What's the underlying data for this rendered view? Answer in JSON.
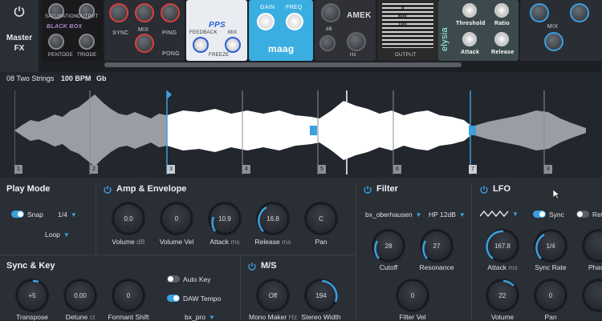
{
  "fx": {
    "label_line1": "Master",
    "label_line2": "FX",
    "plugins": {
      "blackbox": {
        "saturation": "SATURATION",
        "output": "OUTPUT",
        "brand": "BLACK BOX",
        "pentode": "PENTODE",
        "triode": "TRIODE"
      },
      "delay": {
        "sync": "SYNC",
        "mix": "MIX",
        "ping": "PING",
        "pong": "PONG"
      },
      "pps": {
        "brand": "PPS",
        "feedback": "FEEDBACK",
        "mix": "MIX",
        "freeze": "FREEZE"
      },
      "maag": {
        "gain": "GAIN",
        "freq": "FREQ",
        "brand": "maag"
      },
      "amek": {
        "brand": "AMEK",
        "db": "dB",
        "hz": "Hz"
      },
      "spl": {
        "output": "OUTPUT",
        "db1": "0",
        "db2": "800",
        "db3": "100"
      },
      "elysia": {
        "brand": "elysia",
        "threshold": "Threshold",
        "ratio": "Ratio",
        "attack": "Attack",
        "release": "Release"
      },
      "last": {
        "mix": "MIX"
      }
    }
  },
  "sample": {
    "name": "08 Two Strings",
    "bpm": "100 BPM",
    "key": "Gb"
  },
  "slices": [
    "1",
    "2",
    "3",
    "4",
    "5",
    "6",
    "7",
    "8"
  ],
  "play_mode": {
    "title": "Play Mode",
    "snap_label": "Snap",
    "snap_value": "1/4",
    "loop_value": "Loop"
  },
  "amp": {
    "title": "Amp & Envelope",
    "knobs": [
      {
        "value": "0.0",
        "label": "Volume",
        "unit": "dB"
      },
      {
        "value": "0",
        "label": "Volume Vel",
        "unit": ""
      },
      {
        "value": "10.9",
        "label": "Attack",
        "unit": "ms"
      },
      {
        "value": "16.8",
        "label": "Release",
        "unit": "ms"
      },
      {
        "value": "C",
        "label": "Pan",
        "unit": ""
      }
    ]
  },
  "filter": {
    "title": "Filter",
    "type": "bx_oberhausen",
    "mode": "HP 12dB",
    "cutoff": {
      "value": "28",
      "label": "Cutoff"
    },
    "resonance": {
      "value": "27",
      "label": "Resonance"
    },
    "vel": {
      "value": "0",
      "label": "Filter Vel"
    }
  },
  "lfo": {
    "title": "LFO",
    "sync_label": "Sync",
    "ret_label": "Ret",
    "attack": {
      "value": "167.8",
      "label": "Attack",
      "unit": "ms"
    },
    "rate": {
      "value": "1/4",
      "label": "Sync Rate"
    },
    "phase": {
      "label": "Phas"
    },
    "volume": {
      "value": "22",
      "label": "Volume"
    },
    "pan": {
      "value": "0",
      "label": "Pan"
    }
  },
  "sync": {
    "title": "Sync & Key",
    "transpose": {
      "value": "+5",
      "label": "Transpose"
    },
    "detune": {
      "value": "0.00",
      "label": "Detune",
      "unit": "ct"
    },
    "formant": {
      "value": "0",
      "label": "Formant Shift"
    },
    "auto_key": "Auto Key",
    "daw_tempo": "DAW Tempo",
    "engine": "bx_pro"
  },
  "ms": {
    "title": "M/S",
    "mono": {
      "value": "Off",
      "label": "Mono Maker",
      "unit": "Hz"
    },
    "width": {
      "value": "194",
      "label": "Stereo Width"
    }
  },
  "colors": {
    "accent": "#3aa0e0",
    "bg": "#22262d",
    "panel": "#2a2e35"
  }
}
